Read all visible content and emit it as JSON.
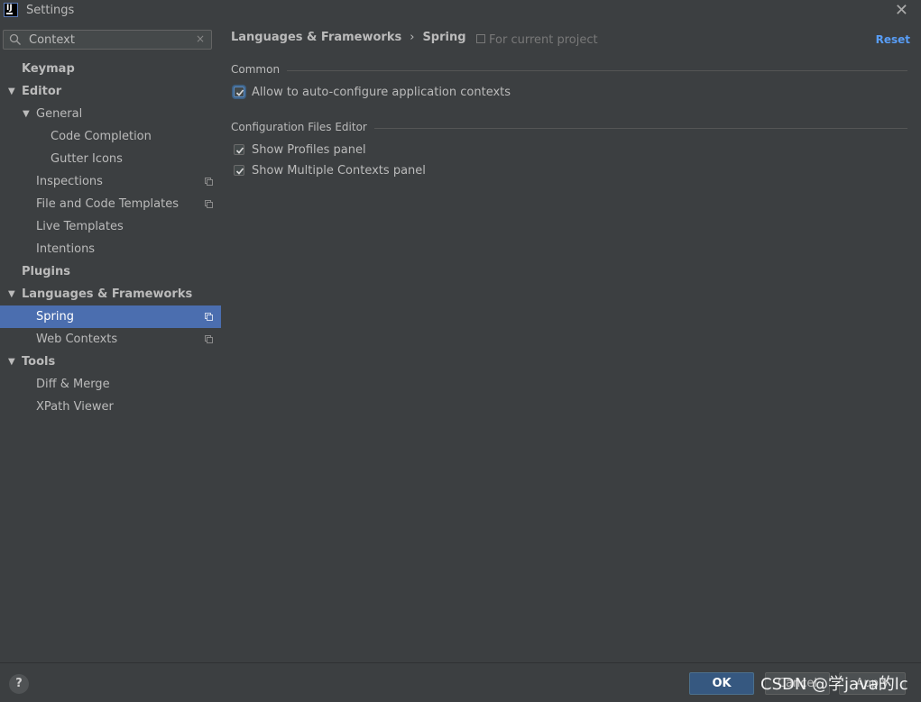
{
  "window": {
    "title": "Settings"
  },
  "search": {
    "value": "Context",
    "clear_icon": "×"
  },
  "tree": {
    "keymap": "Keymap",
    "editor": "Editor",
    "general": "General",
    "code_completion": "Code Completion",
    "gutter_icons": "Gutter Icons",
    "inspections": "Inspections",
    "file_code_templates": "File and Code Templates",
    "live_templates": "Live Templates",
    "intentions": "Intentions",
    "plugins": "Plugins",
    "languages_frameworks": "Languages & Frameworks",
    "spring": "Spring",
    "web_contexts": "Web Contexts",
    "tools": "Tools",
    "diff_merge": "Diff & Merge",
    "xpath_viewer": "XPath Viewer"
  },
  "breadcrumb": {
    "parent": "Languages & Frameworks",
    "separator": "›",
    "current": "Spring"
  },
  "scope_label": "For current project",
  "reset_label": "Reset",
  "sections": {
    "common": {
      "title": "Common",
      "auto_configure": {
        "label": "Allow to auto-configure application contexts",
        "checked": true
      }
    },
    "config_editor": {
      "title": "Configuration Files Editor",
      "show_profiles": {
        "label": "Show Profiles panel",
        "checked": true
      },
      "show_multiple_contexts": {
        "label": "Show Multiple Contexts panel",
        "checked": true
      }
    }
  },
  "footer": {
    "help": "?",
    "ok": "OK",
    "cancel": "Cancel",
    "apply": "Apply",
    "watermark": "CSDN @学java的lc"
  },
  "colors": {
    "background": "#3c3f41",
    "selection": "#4b6eaf",
    "link": "#589df6",
    "ok_button": "#365880"
  }
}
